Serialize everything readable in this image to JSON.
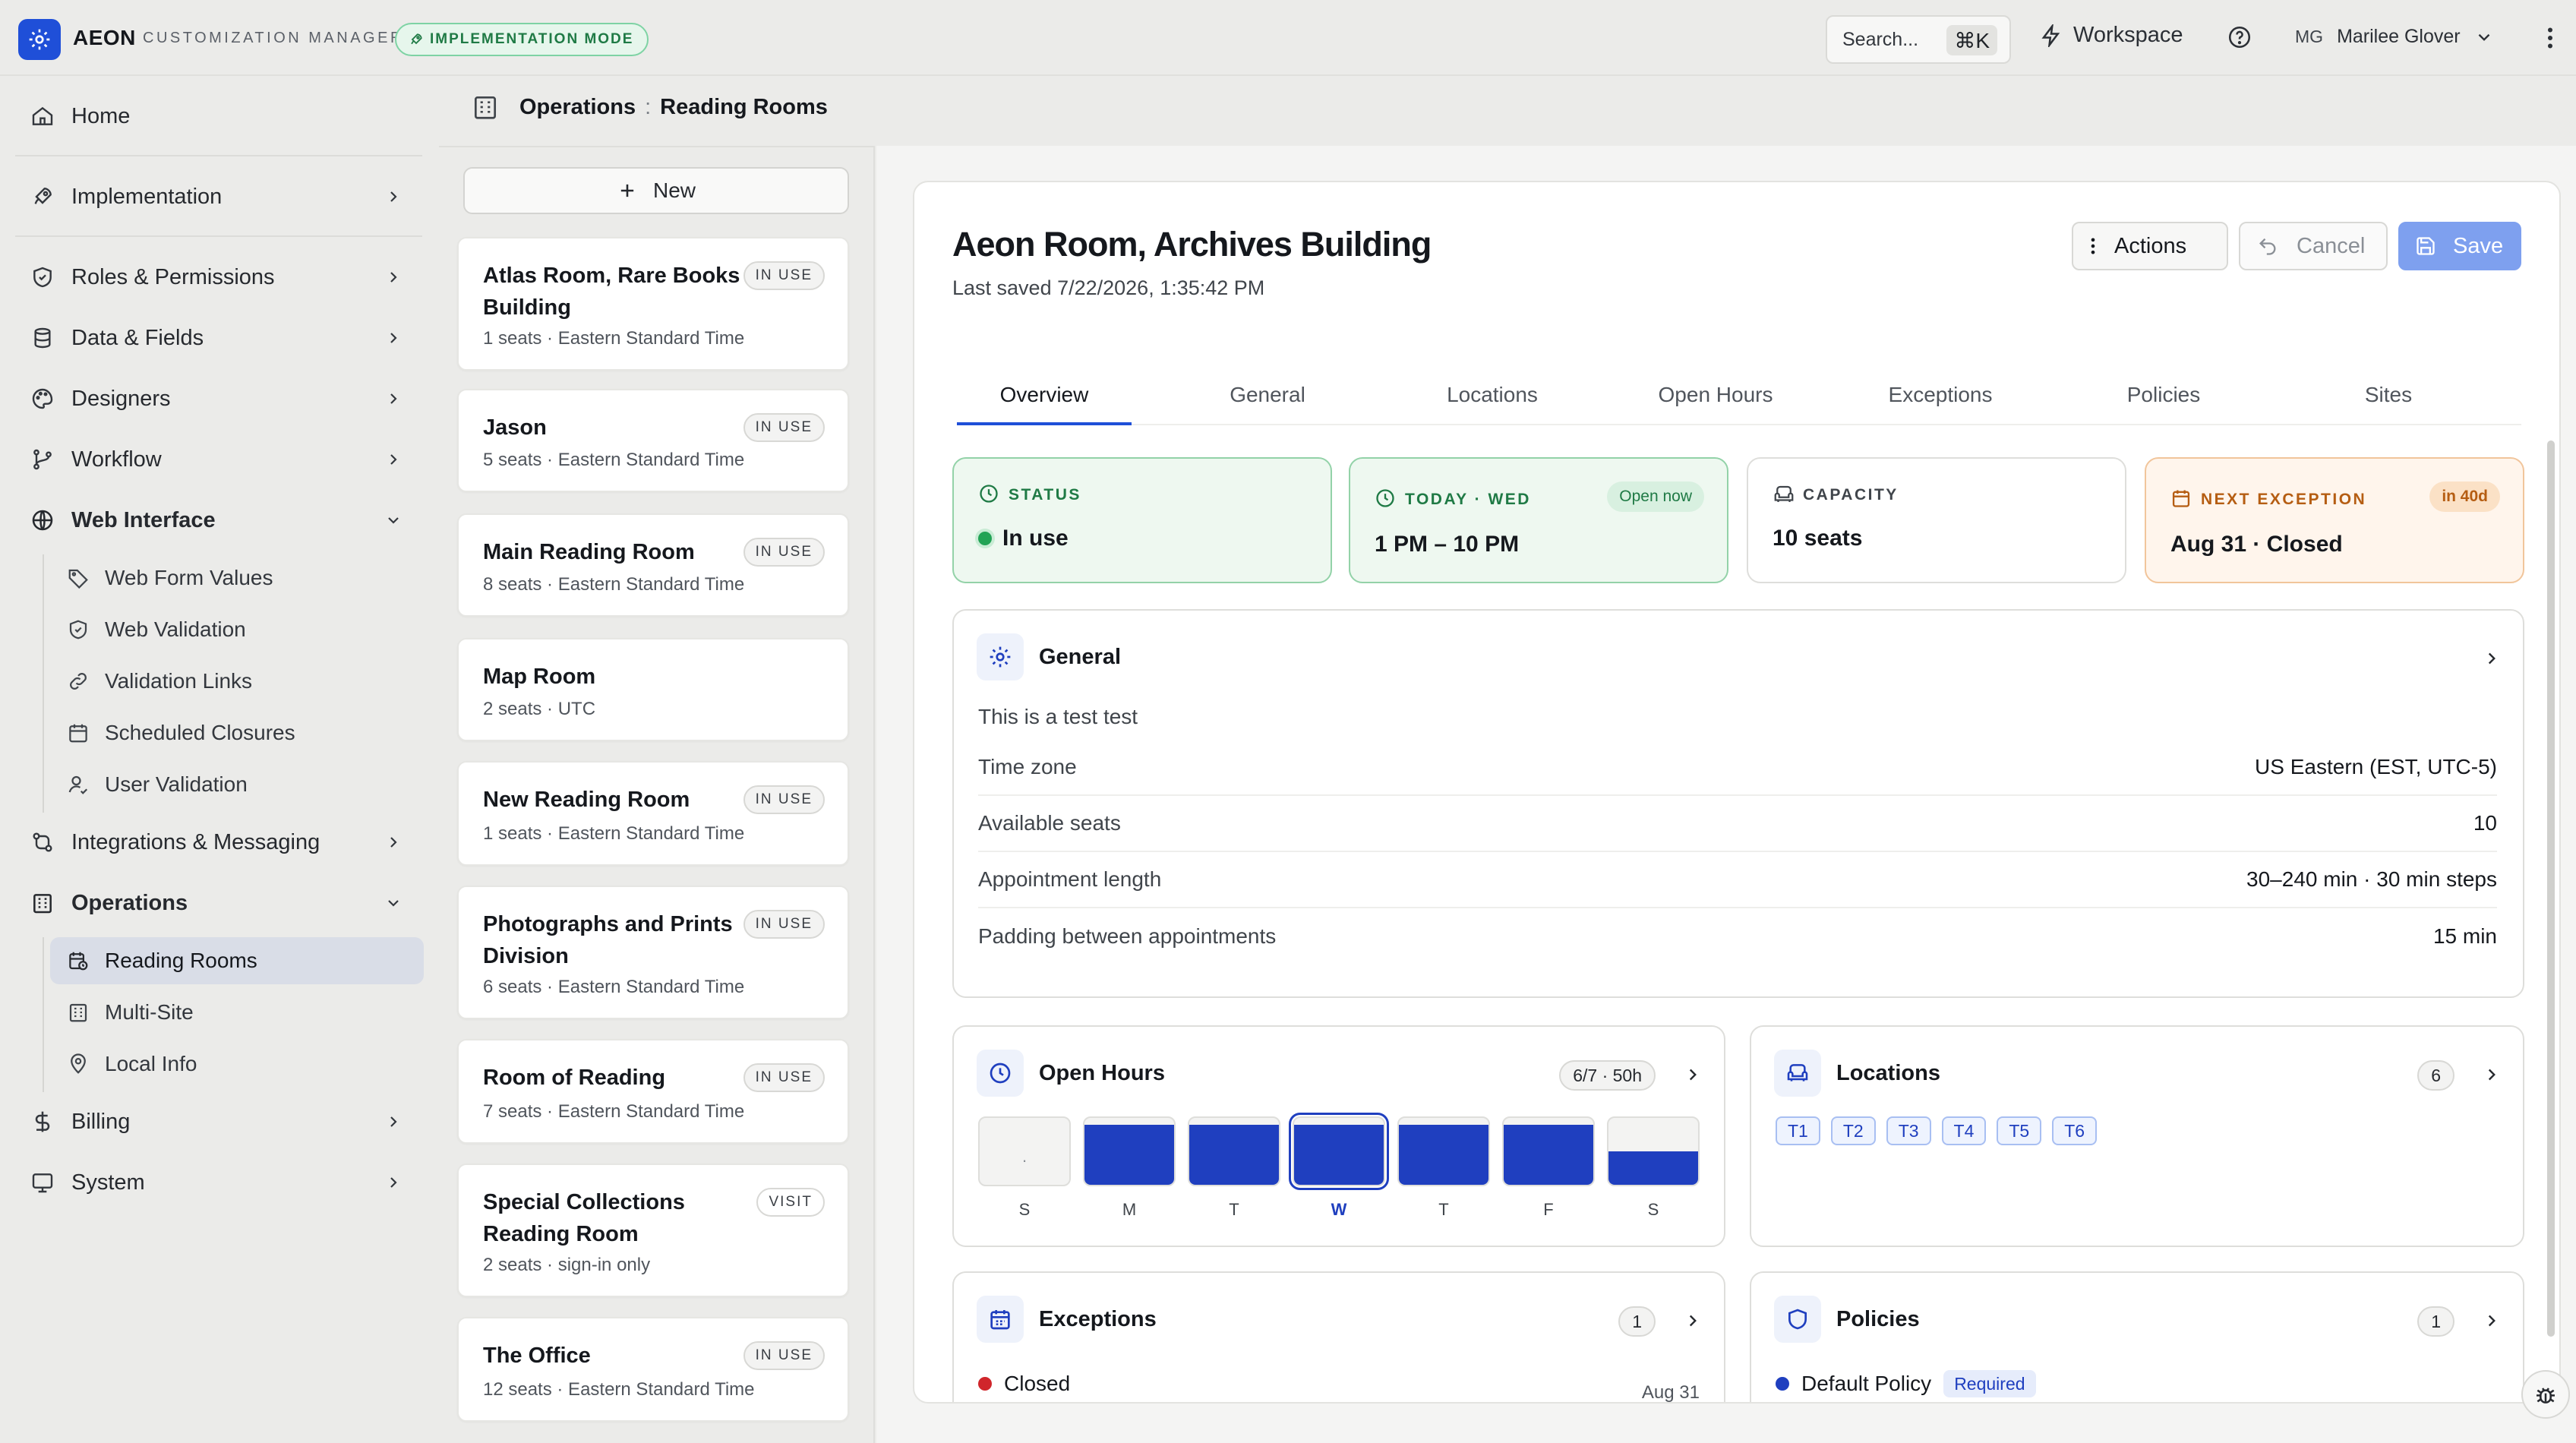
{
  "header": {
    "brand": "AEON",
    "subtitle": "CUSTOMIZATION MANAGER",
    "mode": "IMPLEMENTATION MODE",
    "search_label": "Search...",
    "search_kbd": "⌘K",
    "workspace": "Workspace",
    "user_initials": "MG",
    "user_name": "Marilee Glover"
  },
  "sidebar": {
    "home": "Home",
    "implementation": "Implementation",
    "roles": "Roles & Permissions",
    "data_fields": "Data & Fields",
    "designers": "Designers",
    "workflow": "Workflow",
    "web_interface": "Web Interface",
    "web_sub": [
      "Web Form Values",
      "Web Validation",
      "Validation Links",
      "Scheduled Closures",
      "User Validation"
    ],
    "integrations": "Integrations & Messaging",
    "operations": "Operations",
    "ops_sub": [
      "Reading Rooms",
      "Multi-Site",
      "Local Info"
    ],
    "billing": "Billing",
    "system": "System"
  },
  "breadcrumb": {
    "section": "Operations",
    "page": "Reading Rooms"
  },
  "list": {
    "new_label": "New",
    "rooms": [
      {
        "name": "Atlas Room, Rare Books Building",
        "meta": "1 seats · Eastern Standard Time",
        "badge": "IN USE"
      },
      {
        "name": "Jason",
        "meta": "5 seats · Eastern Standard Time",
        "badge": "IN USE"
      },
      {
        "name": "Main Reading Room",
        "meta": "8 seats · Eastern Standard Time",
        "badge": "IN USE"
      },
      {
        "name": "Map Room",
        "meta": "2 seats · UTC",
        "badge": ""
      },
      {
        "name": "New Reading Room",
        "meta": "1 seats · Eastern Standard Time",
        "badge": "IN USE"
      },
      {
        "name": "Photographs and Prints Division",
        "meta": "6 seats · Eastern Standard Time",
        "badge": "IN USE"
      },
      {
        "name": "Room of Reading",
        "meta": "7 seats · Eastern Standard Time",
        "badge": "IN USE"
      },
      {
        "name": "Special Collections Reading Room",
        "meta": "2 seats · sign-in only",
        "badge": "VISIT"
      },
      {
        "name": "The Office",
        "meta": "12 seats · Eastern Standard Time",
        "badge": "IN USE"
      }
    ]
  },
  "detail": {
    "title": "Aeon Room, Archives Building",
    "last_saved": "Last saved 7/22/2026, 1:35:42 PM",
    "actions_label": "Actions",
    "cancel_label": "Cancel",
    "save_label": "Save",
    "tabs": [
      "Overview",
      "General",
      "Locations",
      "Open Hours",
      "Exceptions",
      "Policies",
      "Sites"
    ],
    "stats": {
      "status_label": "STATUS",
      "status_value": "In use",
      "today_label": "TODAY · WED",
      "today_pill": "Open now",
      "today_value": "1 PM – 10 PM",
      "capacity_label": "CAPACITY",
      "capacity_value": "10 seats",
      "next_label": "NEXT EXCEPTION",
      "next_pill": "in 40d",
      "next_value": "Aug 31 · Closed"
    },
    "general": {
      "title": "General",
      "description": "This is a test test",
      "rows": [
        {
          "k": "Time zone",
          "v": "US Eastern (EST, UTC-5)"
        },
        {
          "k": "Available seats",
          "v": "10"
        },
        {
          "k": "Appointment length",
          "v": "30–240 min · 30 min steps"
        },
        {
          "k": "Padding between appointments",
          "v": "15 min"
        }
      ]
    },
    "open_hours": {
      "title": "Open Hours",
      "summary": "6/7 · 50h",
      "days": [
        {
          "label": "S",
          "fill": 0
        },
        {
          "label": "M",
          "fill": 0.9
        },
        {
          "label": "T",
          "fill": 0.9
        },
        {
          "label": "W",
          "fill": 0.9
        },
        {
          "label": "T",
          "fill": 0.9
        },
        {
          "label": "F",
          "fill": 0.9
        },
        {
          "label": "S",
          "fill": 0.5
        }
      ],
      "empty_mark": "."
    },
    "locations": {
      "title": "Locations",
      "count": "6",
      "chips": [
        "T1",
        "T2",
        "T3",
        "T4",
        "T5",
        "T6"
      ]
    },
    "exceptions": {
      "title": "Exceptions",
      "count": "1",
      "first": "Closed",
      "first_date": "Aug 31"
    },
    "policies": {
      "title": "Policies",
      "count": "1",
      "first": "Default Policy",
      "first_tag": "Required"
    },
    "colors": {
      "accent": "#1f4fd8",
      "hours_fill": "#1f3fbf",
      "status_green": "#22a355"
    }
  }
}
